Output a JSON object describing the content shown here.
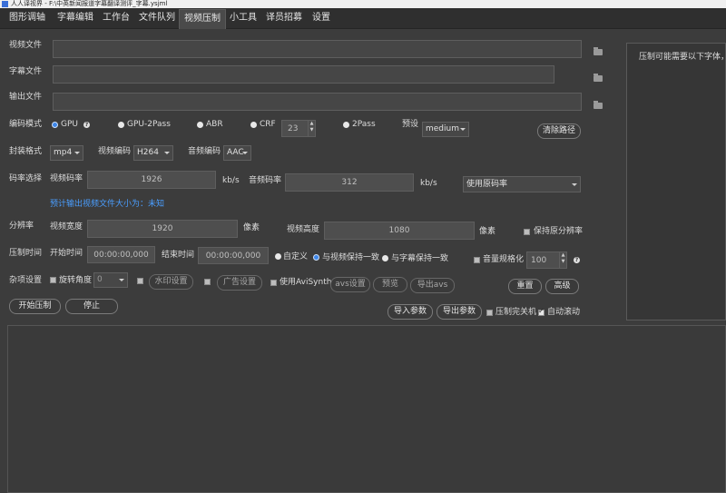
{
  "window": {
    "title": "人人译视界 - F:\\中英新闻报道字幕翻译测评_字幕.ysjml"
  },
  "tabs": [
    {
      "label": "图形调轴"
    },
    {
      "label": "字幕编辑"
    },
    {
      "label": "工作台"
    },
    {
      "label": "文件队列"
    },
    {
      "label": "视频压制",
      "active": true
    },
    {
      "label": "小工具"
    },
    {
      "label": "译员招募"
    },
    {
      "label": "设置"
    }
  ],
  "files": {
    "video_label": "视频文件",
    "subtitle_label": "字幕文件",
    "output_label": "输出文件"
  },
  "encode": {
    "label": "编码模式",
    "gpu": "GPU",
    "gpu2pass": "GPU-2Pass",
    "abr": "ABR",
    "crf": "CRF",
    "crf_value": "23",
    "twopass": "2Pass",
    "preset_label": "预设",
    "preset_value": "medium",
    "selected": "GPU"
  },
  "buttons": {
    "clear_path": "清除路径",
    "watermark": "水印设置",
    "ad": "广告设置",
    "avs": "avs设置",
    "preview": "预览",
    "export_avs": "导出avs",
    "reset": "重置",
    "advanced": "高级",
    "import": "导入参数",
    "export": "导出参数",
    "start": "开始压制",
    "stop": "停止"
  },
  "container": {
    "label": "封装格式",
    "value": "mp4",
    "vcodec_label": "视频编码",
    "vcodec_value": "H264",
    "acodec_label": "音频编码",
    "acodec_value": "AAC"
  },
  "bitrate": {
    "label": "码率选择",
    "video_label": "视频码率",
    "video_value": "1926",
    "unit": "kb/s",
    "audio_label": "音频码率",
    "audio_value": "312",
    "mode_value": "使用原码率",
    "estimate": "预计输出视频文件大小为：未知"
  },
  "resolution": {
    "label": "分辨率",
    "width_label": "视频宽度",
    "width_value": "1920",
    "unit": "像素",
    "height_label": "视频高度",
    "height_value": "1080",
    "keep_label": "保持原分辨率"
  },
  "time": {
    "label": "压制时间",
    "start_label": "开始时间",
    "start_value": "00:00:00,000",
    "end_label": "结束时间",
    "end_value": "00:00:00,000",
    "custom": "自定义",
    "keep_video": "与视频保持一致",
    "keep_subtitle": "与字幕保持一致",
    "volume_label": "音量规格化",
    "volume_value": "100"
  },
  "misc": {
    "label": "杂项设置",
    "rotate_label": "旋转角度",
    "rotate_value": "0",
    "avisynth_label": "使用AviSynth",
    "shutdown_label": "压制完关机",
    "autoscroll_label": "自动滚动"
  },
  "right_panel": {
    "text": "压制可能需要以下字体，"
  },
  "help_icon_text": "?",
  "colors": {
    "accent": "#3d86e8",
    "hint": "#4a9eff"
  }
}
